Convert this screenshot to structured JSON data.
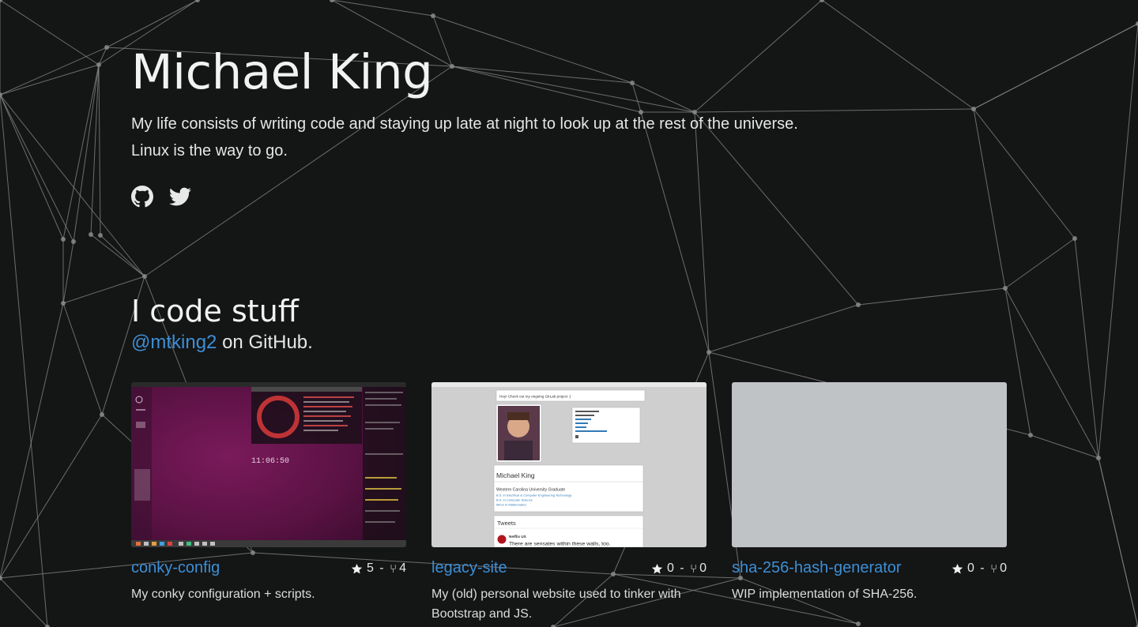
{
  "profile": {
    "name": "Michael King",
    "bio_line1": "My life consists of writing code and staying up late at night to look up at the rest of the universe.",
    "bio_line2": "Linux is the way to go.",
    "social_icons": [
      "github-icon",
      "twitter-icon"
    ]
  },
  "projects_section": {
    "title": "I code stuff",
    "handle": "@mtking2",
    "handle_suffix": " on GitHub."
  },
  "repos": [
    {
      "name": "conky-config",
      "stars": "5",
      "forks": "4",
      "stat_sep": " - ",
      "description": "My conky configuration + scripts.",
      "clock": "11:06:50"
    },
    {
      "name": "legacy-site",
      "stars": "0",
      "forks": "0",
      "stat_sep": " - ",
      "description": "My (old) personal website used to tinker with Bootstrap and JS.",
      "shot": {
        "status": "Hey! Check out my ongoing GitLab project :)",
        "name": "Michael King",
        "school": "Western Carolina University Graduate",
        "degrees": [
          "B.S. in Electrical & Computer Engineering Technology",
          "B.S. in Computer Science",
          "Minor in Mathematics"
        ],
        "tweets_label": "Tweets",
        "tweet_author": "Netflix US",
        "tweet_text": "There are sensates within these walls, too."
      }
    },
    {
      "name": "sha-256-hash-generator",
      "stars": "0",
      "forks": "0",
      "stat_sep": " - ",
      "description": "WIP implementation of SHA-256."
    }
  ],
  "colors": {
    "background": "#141515",
    "link": "#3d8fd6",
    "text": "#e6e6e6",
    "placeholder_thumb": "#c0c3c6"
  }
}
